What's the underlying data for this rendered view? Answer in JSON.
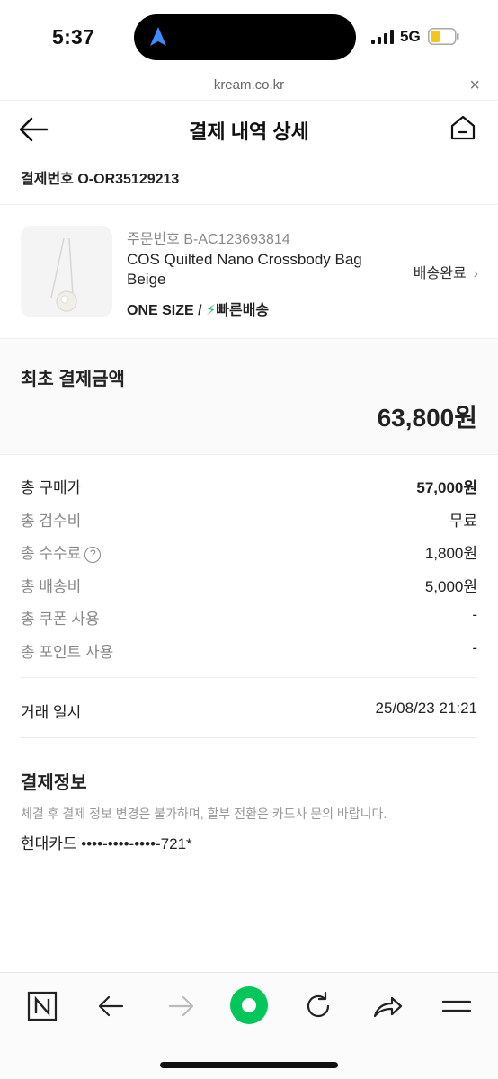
{
  "status_bar": {
    "time": "5:37",
    "network": "5G"
  },
  "browser": {
    "url": "kream.co.kr",
    "close_label": "×"
  },
  "header": {
    "title": "결제 내역 상세"
  },
  "order": {
    "label": "결제번호",
    "number": "O-OR35129213"
  },
  "product": {
    "order_no": "주문번호 B-AC123693814",
    "name": "COS Quilted Nano Crossbody Bag Beige",
    "option": "ONE SIZE / ",
    "shipping": "빠른배송",
    "status": "배송완료"
  },
  "initial_payment": {
    "label": "최초 결제금액",
    "amount": "63,800원"
  },
  "breakdown": [
    {
      "label": "총 구매가",
      "value": "57,000원"
    },
    {
      "label": "총 검수비",
      "value": "무료"
    },
    {
      "label": "총 수수료",
      "value": "1,800원",
      "help": "?"
    },
    {
      "label": "총 배송비",
      "value": "5,000원"
    },
    {
      "label": "총 쿠폰 사용",
      "value": "-"
    },
    {
      "label": "총 포인트 사용",
      "value": "-"
    }
  ],
  "transaction": {
    "label": "거래 일시",
    "value": "25/08/23 21:21"
  },
  "payment_info": {
    "title": "결제정보",
    "note": "체결 후 결제 정보 변경은 불가하며, 할부 전환은 카드사 문의 바랍니다.",
    "card": "현대카드 ••••-••••-••••-721*"
  },
  "toolbar": {
    "icons": [
      "naver-icon",
      "back-arrow-icon",
      "forward-arrow-icon",
      "green-dot-icon",
      "reload-icon",
      "share-icon",
      "menu-icon"
    ],
    "accent": "#03c75a"
  },
  "colors": {
    "bolt": "#31b46e",
    "battery": "#f5c518"
  }
}
